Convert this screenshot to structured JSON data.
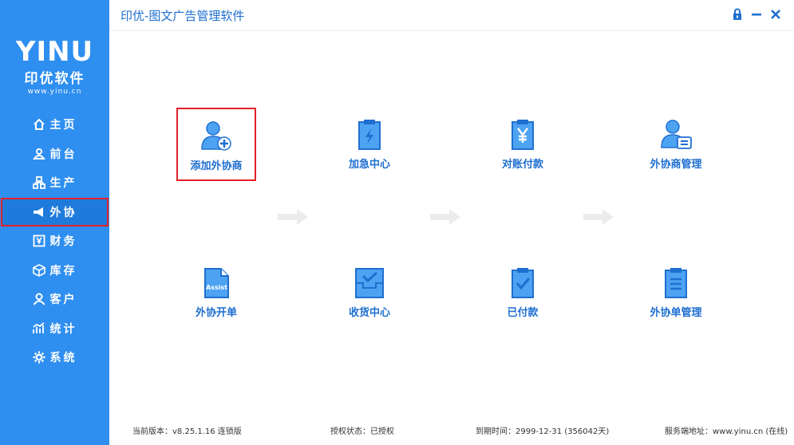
{
  "brand": {
    "logo_mark": "YINU",
    "name": "印优软件",
    "url": "www.yinu.cn"
  },
  "sidebar": {
    "items": [
      {
        "label": "主页",
        "icon": "home-icon"
      },
      {
        "label": "前台",
        "icon": "user-front-icon"
      },
      {
        "label": "生产",
        "icon": "org-chart-icon"
      },
      {
        "label": "外协",
        "icon": "share-icon",
        "active": true
      },
      {
        "label": "财务",
        "icon": "yen-box-icon"
      },
      {
        "label": "库存",
        "icon": "box-icon"
      },
      {
        "label": "客户",
        "icon": "user-icon"
      },
      {
        "label": "统计",
        "icon": "chart-icon"
      },
      {
        "label": "系统",
        "icon": "gear-icon"
      }
    ]
  },
  "titlebar": {
    "title": "印优-图文广告管理软件"
  },
  "tiles": [
    {
      "label": "添加外协商",
      "icon": "user-add-icon",
      "selected": true
    },
    {
      "label": "加急中心",
      "icon": "clipboard-lightning-icon"
    },
    {
      "label": "对账付款",
      "icon": "clipboard-yen-icon"
    },
    {
      "label": "外协商管理",
      "icon": "user-card-icon"
    },
    {
      "label": "外协开单",
      "icon": "document-assist-icon",
      "icon_text": "Assist"
    },
    {
      "label": "收货中心",
      "icon": "inbox-check-icon"
    },
    {
      "label": "已付款",
      "icon": "clipboard-check-icon"
    },
    {
      "label": "外协单管理",
      "icon": "clipboard-list-icon"
    }
  ],
  "status": {
    "version": "当前版本：v8.25.1.16  连锁版",
    "license": "授权状态：已授权",
    "expiry": "到期时间：2999-12-31 (356042天)",
    "server": "服务端地址：www.yinu.cn (在线)"
  },
  "colors": {
    "sidebar": "#2f8ff0",
    "accent": "#1f6fd0",
    "highlight": "#e42128",
    "icon_fill": "#4da3f2"
  }
}
